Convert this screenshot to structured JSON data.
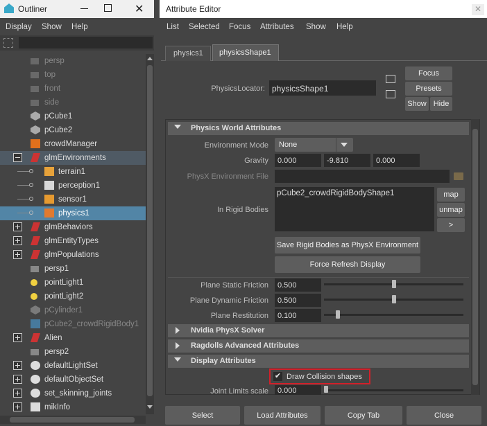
{
  "outliner": {
    "title": "Outliner",
    "menu": [
      "Display",
      "Show",
      "Help"
    ],
    "items": [
      {
        "label": "persp",
        "dim": true,
        "icon": "camera-icon"
      },
      {
        "label": "top",
        "dim": true,
        "icon": "camera-icon"
      },
      {
        "label": "front",
        "dim": true,
        "icon": "camera-icon"
      },
      {
        "label": "side",
        "dim": true,
        "icon": "camera-icon"
      },
      {
        "label": "pCube1",
        "dim": false,
        "icon": "mesh-icon"
      },
      {
        "label": "pCube2",
        "dim": false,
        "icon": "mesh-icon"
      },
      {
        "label": "crowdManager",
        "dim": false,
        "icon": "crowd-manager-icon"
      },
      {
        "label": "glmEnvironments",
        "dim": false,
        "icon": "golaem-icon"
      },
      {
        "label": "terrain1",
        "dim": false,
        "icon": "terrain-icon"
      },
      {
        "label": "perception1",
        "dim": false,
        "icon": "perception-icon"
      },
      {
        "label": "sensor1",
        "dim": false,
        "icon": "sensor-icon"
      },
      {
        "label": "physics1",
        "dim": false,
        "icon": "physics-icon"
      },
      {
        "label": "glmBehaviors",
        "dim": false,
        "icon": "golaem-icon"
      },
      {
        "label": "glmEntityTypes",
        "dim": false,
        "icon": "golaem-icon"
      },
      {
        "label": "glmPopulations",
        "dim": false,
        "icon": "golaem-icon"
      },
      {
        "label": "persp1",
        "dim": false,
        "icon": "camera-icon"
      },
      {
        "label": "pointLight1",
        "dim": false,
        "icon": "light-icon"
      },
      {
        "label": "pointLight2",
        "dim": false,
        "icon": "light-icon"
      },
      {
        "label": "pCylinder1",
        "dim": true,
        "icon": "mesh-icon"
      },
      {
        "label": "pCube2_crowdRigidBody1",
        "dim": true,
        "icon": "rigid-body-icon"
      },
      {
        "label": "Alien",
        "dim": false,
        "icon": "golaem-icon"
      },
      {
        "label": "persp2",
        "dim": false,
        "icon": "camera-icon"
      },
      {
        "label": "defaultLightSet",
        "dim": false,
        "icon": "set-icon"
      },
      {
        "label": "defaultObjectSet",
        "dim": false,
        "icon": "set-icon"
      },
      {
        "label": "set_skinning_joints",
        "dim": false,
        "icon": "set-icon"
      },
      {
        "label": "mikInfo",
        "dim": false,
        "icon": "info-icon"
      }
    ]
  },
  "attr": {
    "title": "Attribute Editor",
    "menu": [
      "List",
      "Selected",
      "Focus",
      "Attributes",
      "Show",
      "Help"
    ],
    "tabs": [
      "physics1",
      "physicsShape1"
    ],
    "locator_label": "PhysicsLocator:",
    "locator_value": "physicsShape1",
    "focus": "Focus",
    "presets": "Presets",
    "show": "Show",
    "hide": "Hide",
    "sec_world": "Physics World Attributes",
    "env_mode_label": "Environment Mode",
    "env_mode_value": "None",
    "gravity_label": "Gravity",
    "gravity": [
      "0.000",
      "-9.810",
      "0.000"
    ],
    "physx_file_label": "PhysX Environment File",
    "rigid_label": "In Rigid Bodies",
    "rigid_value": "pCube2_crowdRigidBodyShape1",
    "map": "map",
    "unmap": "unmap",
    "gt": ">",
    "save_btn": "Save Rigid Bodies as PhysX Environment",
    "refresh_btn": "Force Refresh Display",
    "static_label": "Plane Static Friction",
    "static_value": "0.500",
    "static_level": 0.5,
    "dynamic_label": "Plane Dynamic Friction",
    "dynamic_value": "0.500",
    "dynamic_level": 0.5,
    "restitution_label": "Plane Restitution",
    "restitution_value": "0.100",
    "restitution_level": 0.1,
    "sec_solver": "Nvidia PhysX Solver",
    "sec_ragdoll": "Ragdolls Advanced Attributes",
    "sec_display": "Display Attributes",
    "draw_collision": "Draw Collision shapes",
    "joint_label": "Joint Limits scale",
    "joint_value": "0.000",
    "bottom": [
      "Select",
      "Load Attributes",
      "Copy Tab",
      "Close"
    ]
  },
  "colors": {
    "highlight": "#5285a6",
    "accent_red": "#d2202a"
  }
}
